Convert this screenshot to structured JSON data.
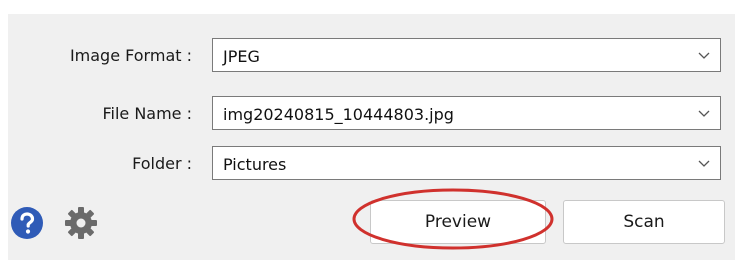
{
  "form": {
    "image_format": {
      "label": "Image Format :",
      "value": "JPEG"
    },
    "file_name": {
      "label": "File Name :",
      "value": "img20240815_10444803.jpg"
    },
    "folder": {
      "label": "Folder :",
      "value": "Pictures"
    }
  },
  "buttons": {
    "preview_label": "Preview",
    "scan_label": "Scan"
  },
  "icons": {
    "help": "help-icon",
    "settings": "gear-icon",
    "dropdown": "chevron-down-icon"
  },
  "colors": {
    "help_icon": "#2f5bb7",
    "gear_icon": "#6b6b6b",
    "highlight_ellipse": "#d0312d",
    "panel_bg": "#f0f0f0"
  }
}
